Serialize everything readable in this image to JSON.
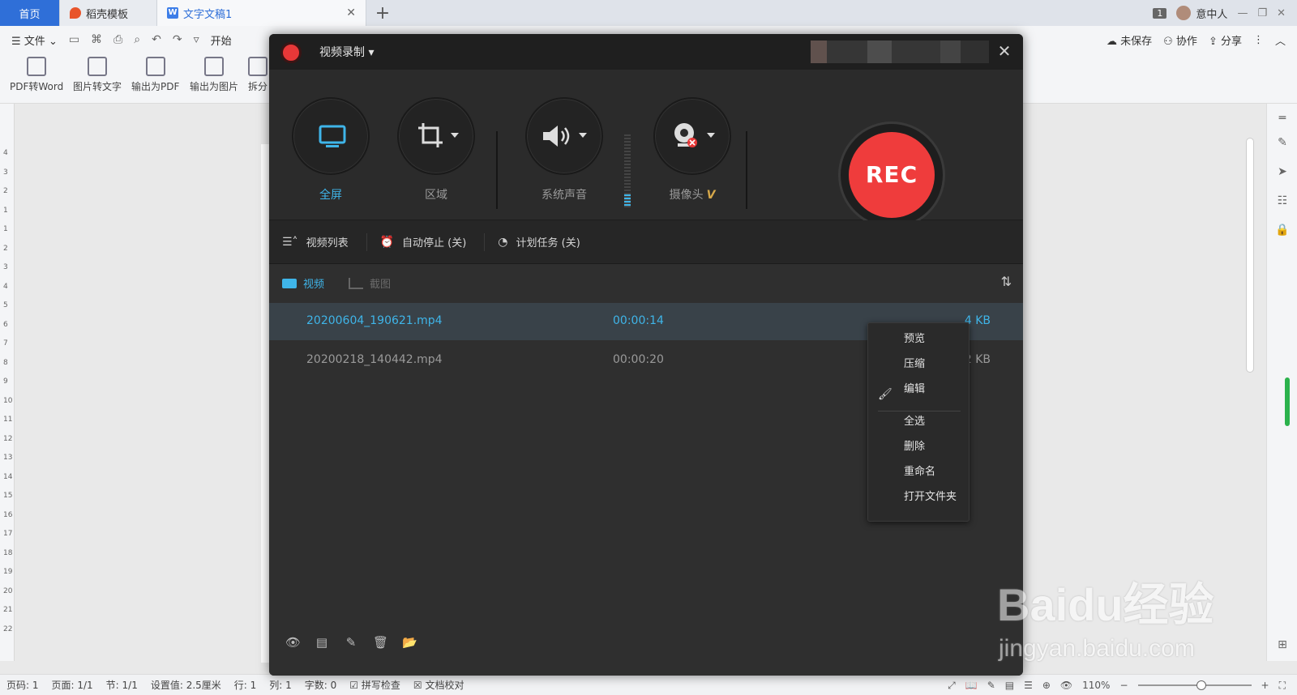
{
  "wps": {
    "tabs": [
      {
        "label": "首页"
      },
      {
        "label": "稻壳模板"
      },
      {
        "label": "文字文稿1"
      }
    ],
    "window": {
      "badge": "1",
      "user": "意中人"
    },
    "menu": {
      "file": "文件",
      "start": "开始",
      "unsaved": "未保存",
      "collab": "协作",
      "share": "分享"
    },
    "ribbon": [
      "PDF转Word",
      "图片转文字",
      "输出为PDF",
      "输出为图片",
      "拆分"
    ],
    "ruler": [
      "4",
      "3",
      "2",
      "1",
      "1",
      "2",
      "3",
      "4",
      "5",
      "6",
      "7",
      "8",
      "9",
      "10",
      "11",
      "12",
      "13",
      "14",
      "15",
      "16",
      "17",
      "18",
      "19",
      "20",
      "21",
      "22"
    ],
    "status": {
      "page_no": "页码: 1",
      "pages": "页面: 1/1",
      "section": "节: 1/1",
      "setting": "设置值: 2.5厘米",
      "row": "行: 1",
      "col": "列: 1",
      "words": "字数: 0",
      "spell": "拼写检查",
      "proof": "文档校对",
      "zoom": "110%"
    }
  },
  "recorder": {
    "title": "视频录制",
    "controls": {
      "fullscreen": "全屏",
      "region": "区域",
      "system_audio": "系统声音",
      "camera": "摄像头",
      "camera_badge": "V",
      "rec": "REC"
    },
    "options": {
      "video_list": "视频列表",
      "auto_stop": "自动停止 (关)",
      "scheduled": "计划任务 (关)"
    },
    "subtabs": {
      "video": "视频",
      "screenshot": "截图"
    },
    "files": [
      {
        "name": "20200604_190621.mp4",
        "duration": "00:00:14",
        "size": "4 KB",
        "selected": true
      },
      {
        "name": "20200218_140442.mp4",
        "duration": "00:00:20",
        "size": "2 KB",
        "selected": false
      }
    ],
    "context_menu": [
      "预览",
      "压缩",
      "编辑",
      "全选",
      "删除",
      "重命名",
      "打开文件夹"
    ]
  },
  "watermark": {
    "logo": "Baidu经验",
    "url": "jingyan.baidu.com"
  },
  "colors": {
    "accent": "#3fb5e9",
    "rec": "#ef3c3c",
    "wps_blue": "#2f6fd8"
  }
}
